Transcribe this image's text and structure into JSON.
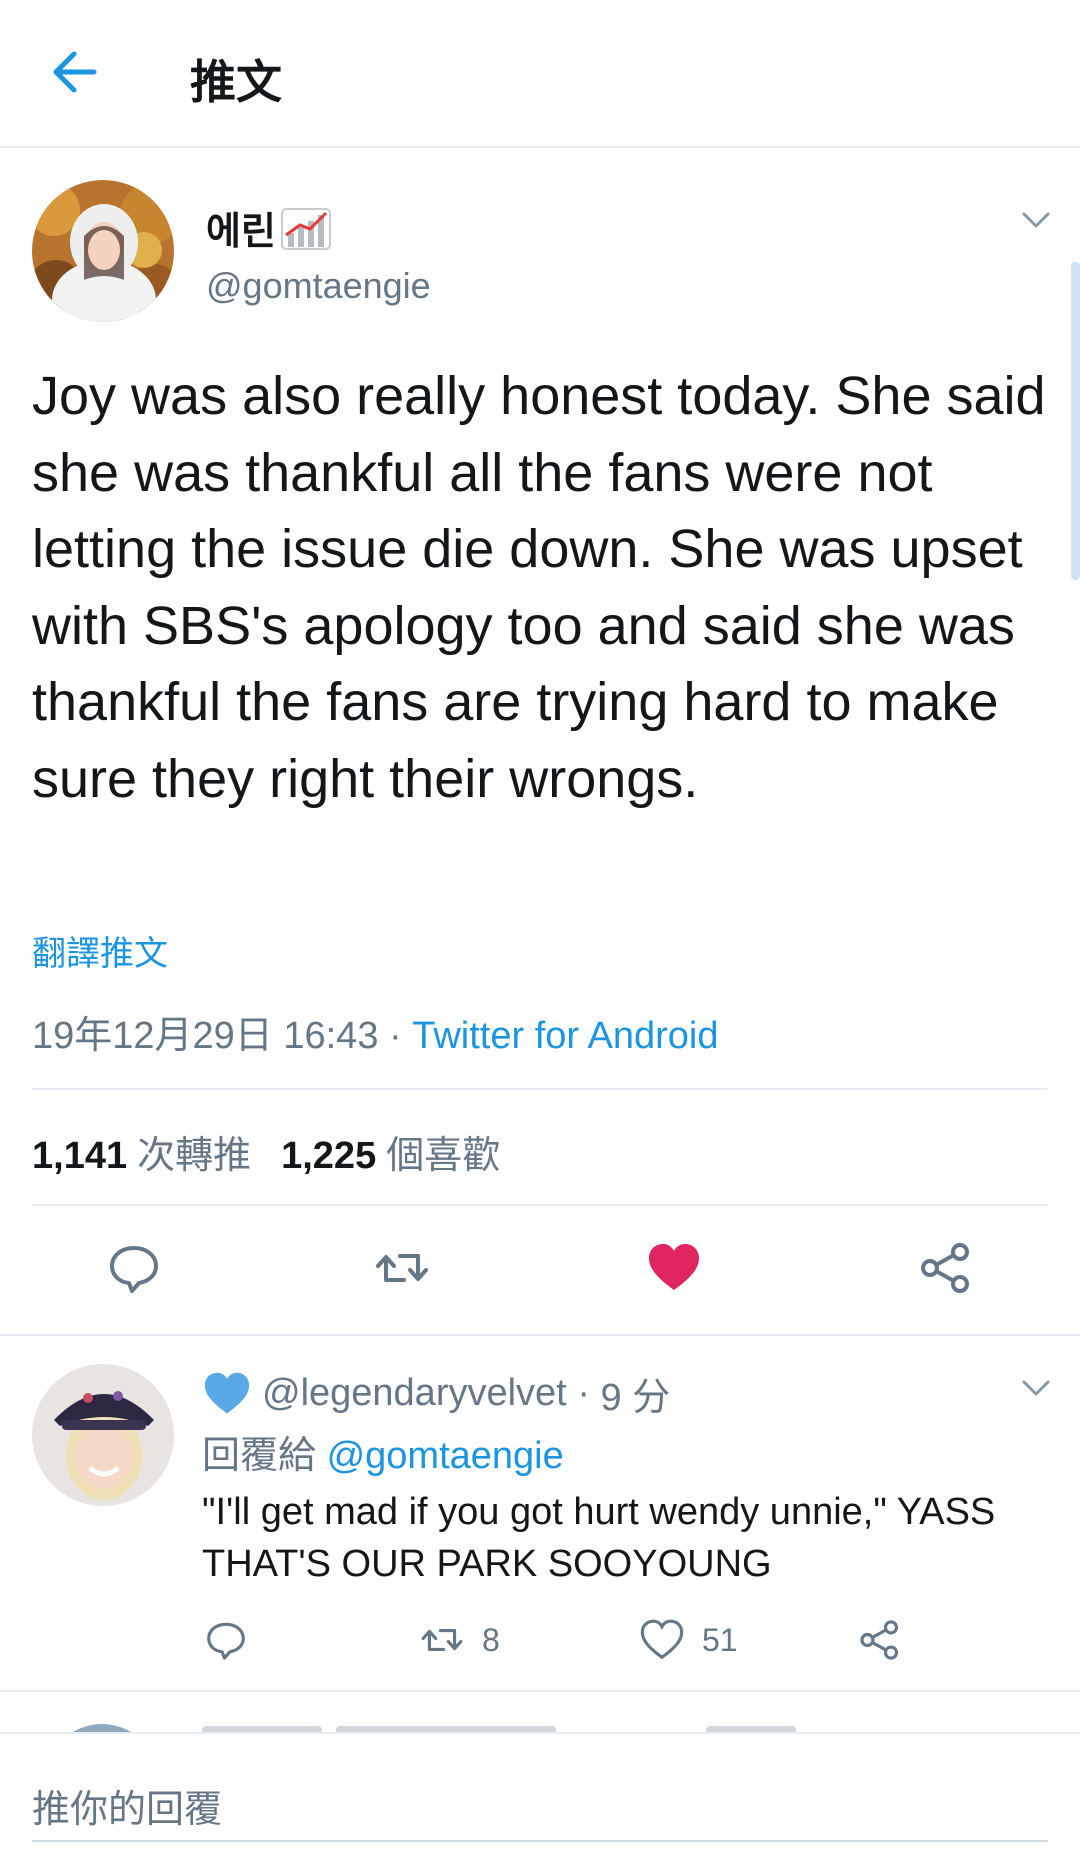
{
  "header": {
    "title": "推文"
  },
  "tweet": {
    "author_name": "에린",
    "author_handle": "@gomtaengie",
    "text": "Joy was also really honest today. She said she was thankful all the fans were not letting the issue die down. She was upset with SBS's apology too and said she was thankful the fans are trying hard to make sure they right their wrongs.",
    "translate_label": "翻譯推文",
    "timestamp": "19年12月29日 16:43",
    "meta_separator": "·",
    "source": "Twitter for Android",
    "retweet_count": "1,141",
    "retweet_label": "次轉推",
    "like_count": "1,225",
    "like_label": "個喜歡",
    "liked": true
  },
  "reply": {
    "handle": "@legendaryvelvet",
    "separator": "·",
    "time": "9 分",
    "replying_label": "回覆給",
    "replying_to": "@gomtaengie",
    "text": "\"I'll get mad if you got hurt wendy unnie,\" YASS THAT'S OUR PARK SOOYOUNG",
    "retweets": "8",
    "likes": "51"
  },
  "composer": {
    "placeholder": "推你的回覆"
  },
  "icons": {
    "back": "arrow-left-icon",
    "caret": "chevron-down-icon",
    "reply": "speech-bubble-icon",
    "retweet": "retweet-icon",
    "like": "heart-icon",
    "share": "share-icon",
    "emoji": "chart-increasing-emoji",
    "blue_heart": "blue-heart-emoji"
  },
  "colors": {
    "accent": "#1b95e0",
    "like": "#e0245e",
    "muted": "#657786",
    "text": "#14171a",
    "divider": "#e6ecf0"
  }
}
